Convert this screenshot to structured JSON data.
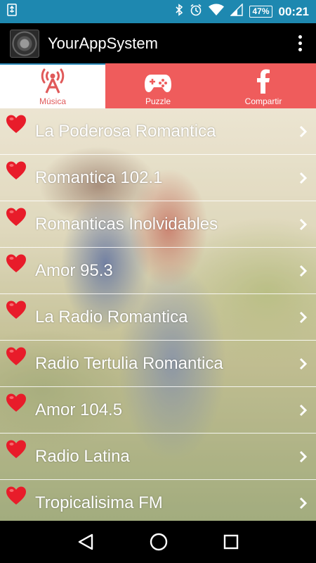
{
  "status_bar": {
    "battery": "47%",
    "time": "00:21",
    "icons": [
      "usb-icon",
      "bluetooth-icon",
      "alarm-icon",
      "wifi-icon",
      "signal-icon",
      "battery-icon"
    ]
  },
  "app_bar": {
    "title": "YourAppSystem"
  },
  "tabs": [
    {
      "label": "Música",
      "icon": "radio-tower-icon",
      "active": true
    },
    {
      "label": "Puzzle",
      "icon": "gamepad-icon",
      "active": false
    },
    {
      "label": "Compartir",
      "icon": "facebook-icon",
      "active": false
    }
  ],
  "stations": [
    {
      "label": "La Poderosa Romantica"
    },
    {
      "label": "Romantica 102.1"
    },
    {
      "label": "Romanticas Inolvidables"
    },
    {
      "label": "Amor 95.3"
    },
    {
      "label": "La Radio Romantica"
    },
    {
      "label": "Radio Tertulia Romantica"
    },
    {
      "label": "Amor 104.5"
    },
    {
      "label": "Radio Latina"
    },
    {
      "label": "Tropicalisima FM"
    }
  ],
  "colors": {
    "status_bar": "#1e88b0",
    "tab_red": "#ef5c5c",
    "heart": "#e81c2a"
  }
}
